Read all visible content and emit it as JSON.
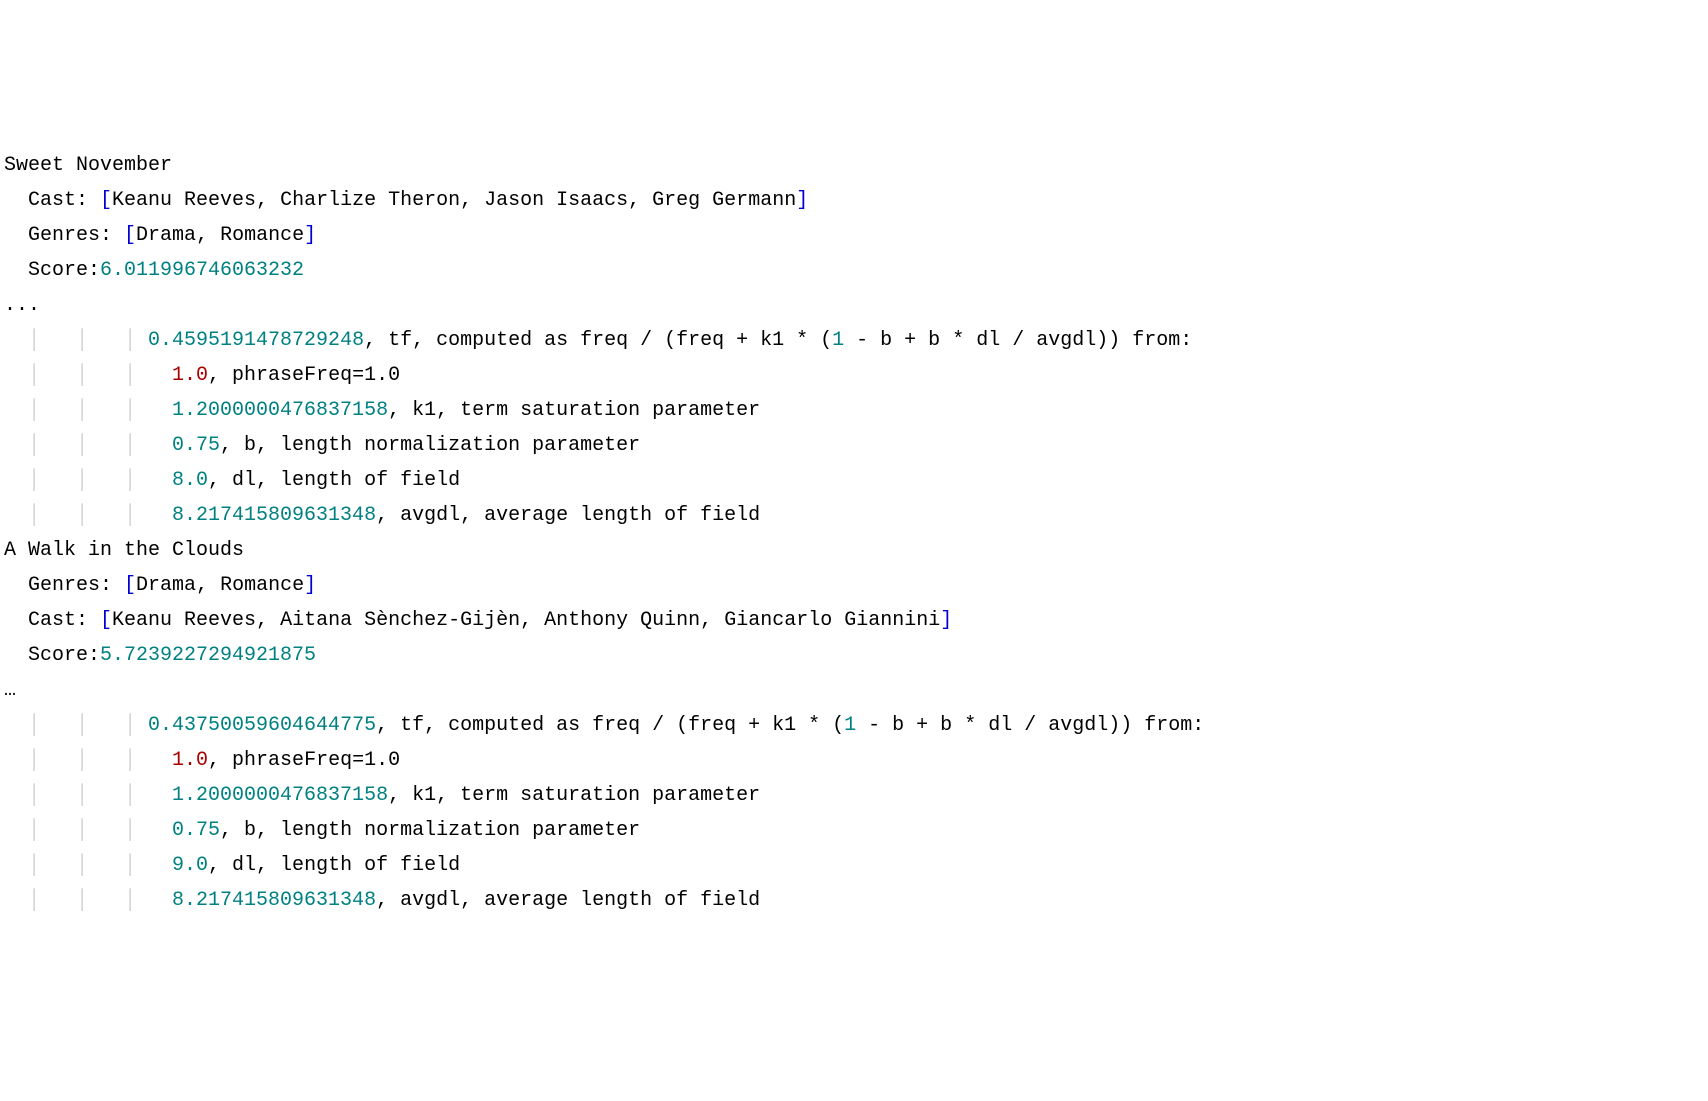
{
  "colors": {
    "text": "#000000",
    "teal": "#008080",
    "blue": "#0000d0",
    "red": "#aa0000",
    "guide": "#d0d0d0"
  },
  "records": [
    {
      "title": "Sweet November",
      "cast_label": "Cast: ",
      "cast": [
        "Keanu Reeves",
        "Charlize Theron",
        "Jason Isaacs",
        "Greg Germann"
      ],
      "genres_label": "Genres: ",
      "genres": [
        "Drama",
        "Romance"
      ],
      "score_label": "Score:",
      "score": "6.011996746063232",
      "ellipsis": "...",
      "tf": {
        "value": "0.4595191478729248",
        "label": ", tf, computed as freq / (freq + k1 * (",
        "one": "1",
        "label2": " - b + b * dl / avgdl)) from:",
        "details": [
          {
            "value": "1.0",
            "suffix": ", phraseFreq=1.0",
            "red": true
          },
          {
            "value": "1.2000000476837158",
            "suffix": ", k1, term saturation parameter"
          },
          {
            "value": "0.75",
            "suffix": ", b, length normalization parameter"
          },
          {
            "value": "8.0",
            "suffix": ", dl, length of field"
          },
          {
            "value": "8.217415809631348",
            "suffix": ", avgdl, average length of field"
          }
        ]
      }
    },
    {
      "title": "A Walk in the Clouds",
      "genres_label": "Genres: ",
      "genres": [
        "Drama",
        "Romance"
      ],
      "cast_label": "Cast: ",
      "cast": [
        "Keanu Reeves",
        "Aitana Sènchez-Gijèn",
        "Anthony Quinn",
        "Giancarlo Giannini"
      ],
      "score_label": "Score:",
      "score": "5.7239227294921875",
      "ellipsis": "…",
      "tf": {
        "value": "0.43750059604644775",
        "label": ", tf, computed as freq / (freq + k1 * (",
        "one": "1",
        "label2": " - b + b * dl / avgdl)) from:",
        "details": [
          {
            "value": "1.0",
            "suffix": ", phraseFreq=1.0",
            "red": true
          },
          {
            "value": "1.2000000476837158",
            "suffix": ", k1, term saturation parameter"
          },
          {
            "value": "0.75",
            "suffix": ", b, length normalization parameter"
          },
          {
            "value": "9.0",
            "suffix": ", dl, length of field"
          },
          {
            "value": "8.217415809631348",
            "suffix": ", avgdl, average length of field"
          }
        ]
      }
    }
  ],
  "guides": {
    "g1": "  ",
    "g4": "  │   │   │ ",
    "g5": "  │   │   │   "
  }
}
